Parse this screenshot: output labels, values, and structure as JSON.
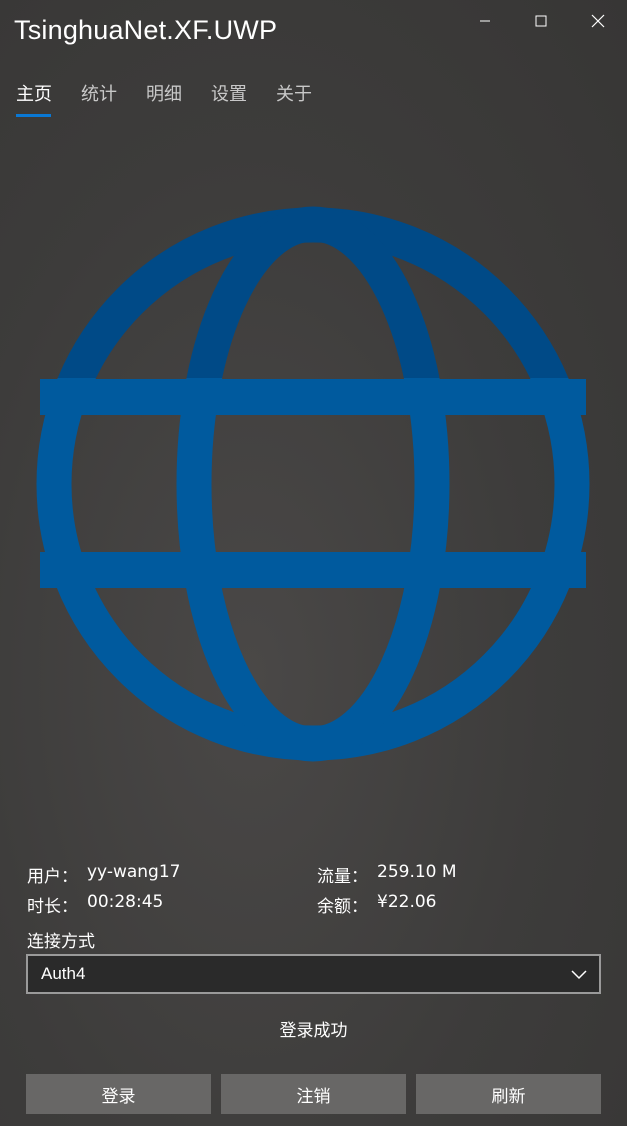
{
  "window": {
    "title": "TsinghuaNet.XF.UWP",
    "controls": {
      "minimize": "minimize-icon",
      "maximize": "maximize-icon",
      "close": "close-icon"
    }
  },
  "tabs": [
    {
      "label": "主页",
      "active": true
    },
    {
      "label": "统计",
      "active": false
    },
    {
      "label": "明细",
      "active": false
    },
    {
      "label": "设置",
      "active": false
    },
    {
      "label": "关于",
      "active": false
    }
  ],
  "colors": {
    "accent": "#0a78d4",
    "globe_fill": "#005a9e",
    "globe_top": "#004a87",
    "button_bg": "#686766",
    "combo_bg": "#2a2a2a"
  },
  "globe": {
    "icon": "globe-icon",
    "fill_level_fraction": 0.7
  },
  "info": {
    "user_label": "用户：",
    "user_value": "yy-wang17",
    "duration_label": "时长：",
    "duration_value": "00:28:45",
    "flow_label": "流量：",
    "flow_value": "259.10 M",
    "balance_label": "余额：",
    "balance_value": "¥22.06"
  },
  "connection": {
    "label": "连接方式",
    "selected": "Auth4"
  },
  "status_text": "登录成功",
  "buttons": {
    "login": "登录",
    "logout": "注销",
    "refresh": "刷新"
  }
}
